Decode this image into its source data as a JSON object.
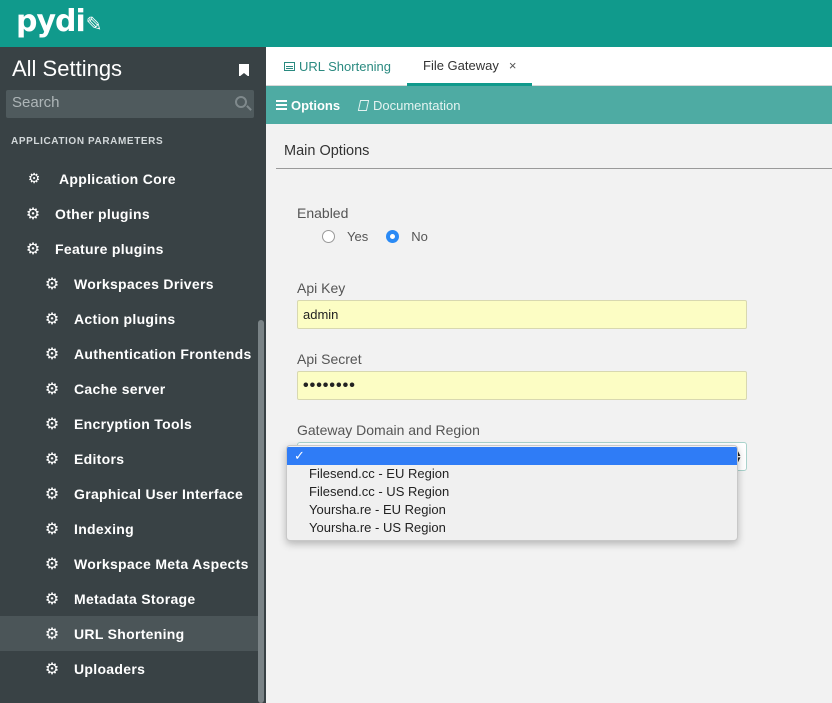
{
  "app": {
    "logo_text": "pydi"
  },
  "sidebar": {
    "title": "All Settings",
    "search_placeholder": "Search",
    "section_label": "APPLICATION PARAMETERS",
    "items": [
      {
        "label": "Application Core"
      },
      {
        "label": "Other plugins"
      },
      {
        "label": "Feature plugins"
      },
      {
        "label": "Workspaces Drivers"
      },
      {
        "label": "Action plugins"
      },
      {
        "label": "Authentication Frontends"
      },
      {
        "label": "Cache server"
      },
      {
        "label": "Encryption Tools"
      },
      {
        "label": "Editors"
      },
      {
        "label": "Graphical User Interface"
      },
      {
        "label": "Indexing"
      },
      {
        "label": "Workspace Meta Aspects"
      },
      {
        "label": "Metadata Storage"
      },
      {
        "label": "URL Shortening"
      },
      {
        "label": "Uploaders"
      }
    ],
    "active_item": "URL Shortening"
  },
  "tabs": [
    {
      "label": "URL Shortening"
    },
    {
      "label": "File Gateway",
      "close": "×"
    }
  ],
  "toolbar": {
    "options_label": "Options",
    "docs_label": "Documentation"
  },
  "form": {
    "section_title": "Main Options",
    "enabled_label": "Enabled",
    "yes_label": "Yes",
    "no_label": "No",
    "enabled_value": "No",
    "api_key_label": "Api Key",
    "api_key_value": "admin",
    "api_secret_label": "Api Secret",
    "api_secret_value": "••••••••",
    "gateway_label": "Gateway Domain and Region",
    "gateway_options": [
      "✓",
      "Filesend.cc - EU Region",
      "Filesend.cc - US Region",
      "Yoursha.re - EU Region",
      "Yoursha.re - US Region"
    ]
  },
  "colors": {
    "topbar": "#109a8c",
    "sidebar": "#394245",
    "subbar": "#4eaba3",
    "input_fill": "#fcfdc4",
    "select_highlight": "#2f7cf6"
  }
}
